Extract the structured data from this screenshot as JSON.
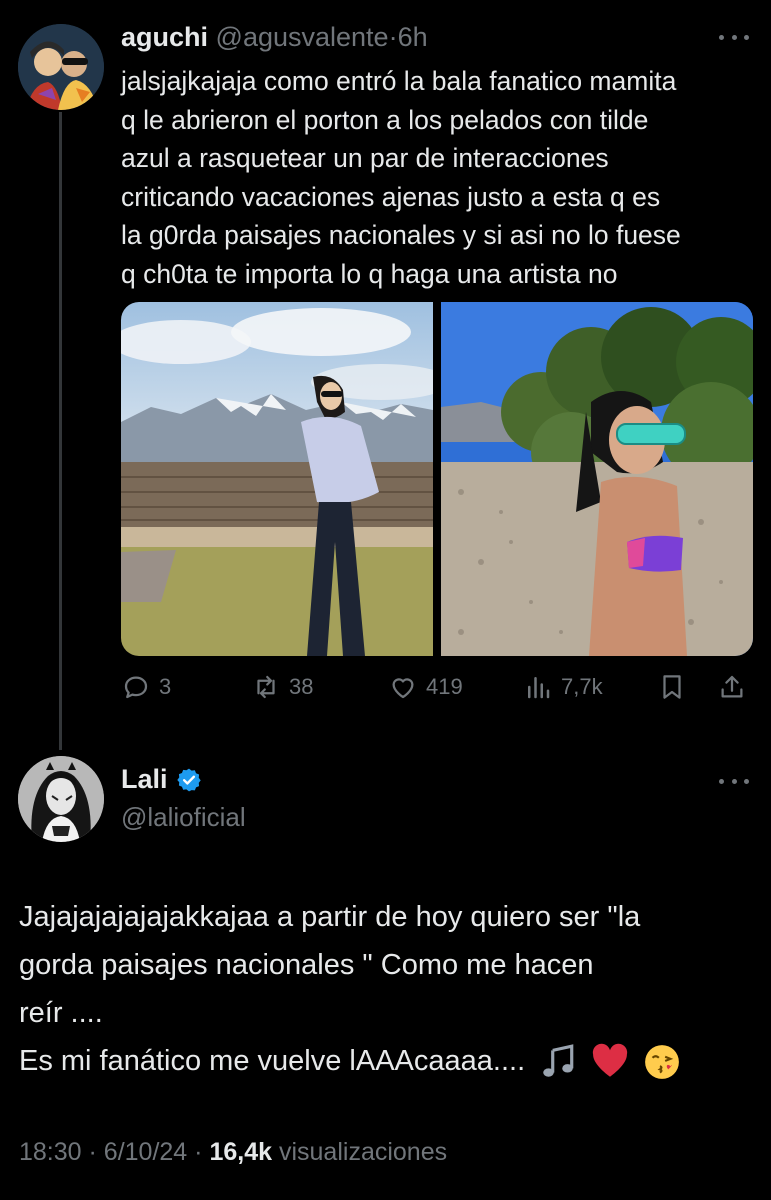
{
  "tweet1": {
    "name": "aguchi",
    "handle": "@agusvalente",
    "separator": "·",
    "time": "6h",
    "lines": [
      "jalsjajkajaja como entró la bala fanatico mamita",
      "q le abrieron el porton a los pelados con tilde",
      "azul a rasquetear un par de interacciones",
      "criticando vacaciones ajenas justo a esta q es",
      "la g0rda paisajes nacionales y si asi no lo fuese",
      "q ch0ta te importa lo q haga una artista no"
    ],
    "actions": {
      "replies": "3",
      "reposts": "38",
      "likes": "419",
      "views": "7,7k"
    }
  },
  "tweet2": {
    "name": "Lali",
    "handle": "@lalioficial",
    "lines": [
      "Jajajajajajajakkajaa a partir de hoy quiero ser \"la",
      "gorda paisajes nacionales \" Como me hacen",
      "reír ....",
      "Es mi fanático me vuelve lAAAcaaaa...."
    ],
    "time": "18:30",
    "separator": "·",
    "date": "6/10/24",
    "views_count": "16,4k",
    "views_label": "visualizaciones"
  },
  "icons": [
    "reply-icon",
    "repost-icon",
    "like-icon",
    "views-icon",
    "bookmark-icon",
    "share-icon",
    "verified-icon",
    "more-icon",
    "music-note-emoji",
    "red-heart-emoji",
    "kiss-face-emoji"
  ],
  "colors": {
    "background": "#000000",
    "text": "#e7e9ea",
    "muted": "#71767b",
    "verified": "#1d9bf0",
    "thread_line": "#333639"
  }
}
